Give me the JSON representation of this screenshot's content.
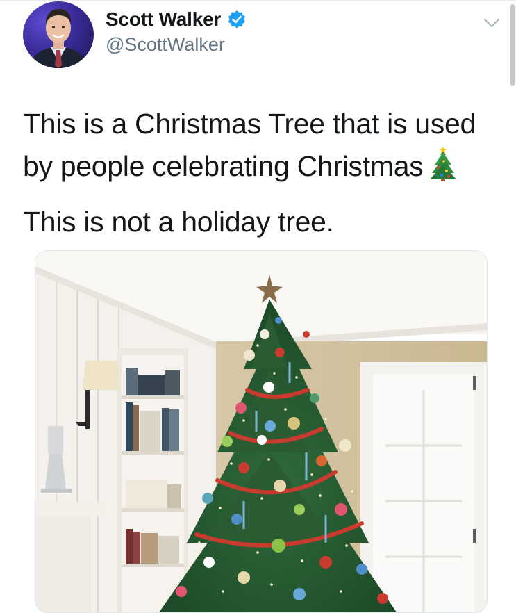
{
  "tweet": {
    "display_name": "Scott Walker",
    "handle": "@ScottWalker",
    "verified": true,
    "verified_icon": "verified-badge-icon",
    "menu_icon": "chevron-down-icon",
    "text_line_1": "This is a Christmas Tree that is used by people celebrating Christmas",
    "emoji": "christmas-tree-emoji",
    "text_line_2": "This is not a holiday tree.",
    "media": {
      "type": "photo",
      "alt": "decorated-christmas-tree-in-living-room"
    }
  },
  "colors": {
    "verified_blue": "#1da1f2",
    "handle_gray": "#657786",
    "text": "#14171a"
  }
}
